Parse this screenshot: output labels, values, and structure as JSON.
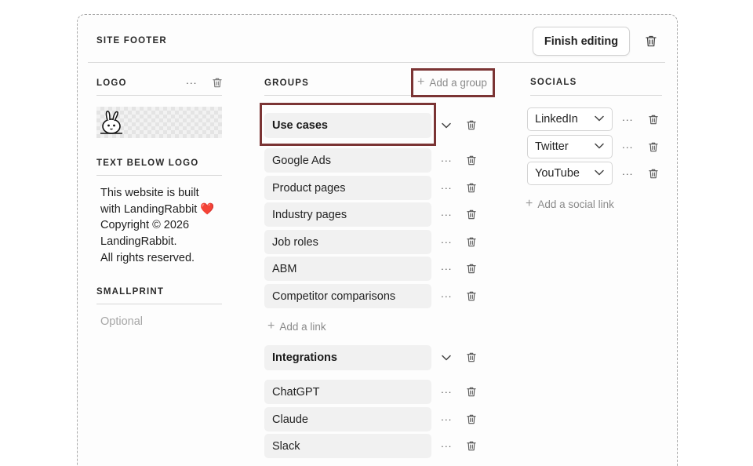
{
  "header": {
    "title": "SITE FOOTER",
    "finish_label": "Finish editing"
  },
  "logo": {
    "label": "LOGO",
    "more_icon": "more-dots-icon",
    "delete_icon": "trash-icon",
    "image_icon": "rabbit-logo-icon"
  },
  "text_below_logo": {
    "label": "TEXT BELOW LOGO",
    "lines": [
      "This website is built",
      "with LandingRabbit ❤️",
      "Copyright © 2026",
      "LandingRabbit.",
      "All rights reserved."
    ]
  },
  "smallprint": {
    "label": "SMALLPRINT",
    "placeholder": "Optional"
  },
  "groups": {
    "label": "GROUPS",
    "add_group_label": "Add a group",
    "add_link_label": "Add a link",
    "items": [
      {
        "name": "Use cases",
        "links": [
          "Google Ads",
          "Product pages",
          "Industry pages",
          "Job roles",
          "ABM",
          "Competitor comparisons"
        ]
      },
      {
        "name": "Integrations",
        "links": [
          "ChatGPT",
          "Claude",
          "Slack"
        ]
      }
    ]
  },
  "socials": {
    "label": "SOCIALS",
    "items": [
      "LinkedIn",
      "Twitter",
      "YouTube"
    ],
    "add_label": "Add a social link"
  },
  "colors": {
    "highlight": "#7b3434",
    "border_dashed": "#a9a9a9",
    "item_bg": "#f1f1f1",
    "muted_text": "#8a8a8a"
  }
}
